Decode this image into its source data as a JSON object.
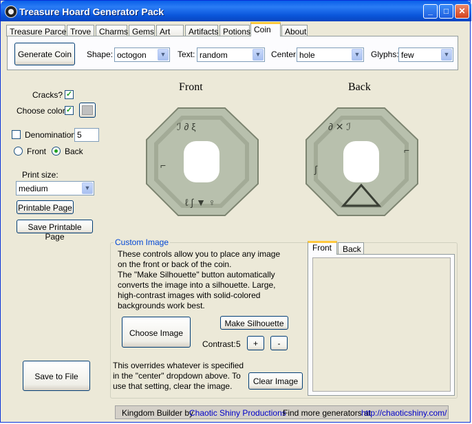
{
  "window": {
    "title": "Treasure Hoard Generator Pack"
  },
  "tabs": [
    "Treasure Parcel",
    "Trove",
    "Charms",
    "Gems",
    "Art",
    "Artifacts",
    "Potions",
    "Coin",
    "About"
  ],
  "toolbar": {
    "generate_label": "Generate Coin",
    "shape_label": "Shape:",
    "shape_value": "octogon",
    "text_label": "Text:",
    "text_value": "random",
    "center_label": "Center:",
    "center_value": "hole",
    "glyphs_label": "Glyphs:",
    "glyphs_value": "few"
  },
  "left": {
    "cracks_label": "Cracks?",
    "cracks_checked": true,
    "color_label": "Choose color",
    "color_checked": true,
    "color_swatch": "#c0c0c0",
    "denomination_label": "Denomination",
    "denomination_value": "5",
    "denomination_checked": false,
    "front_label": "Front",
    "back_label": "Back",
    "selected_side": "Back",
    "print_size_label": "Print size:",
    "print_size_value": "medium",
    "printable_label": "Printable Page",
    "save_printable_label": "Save Printable Page",
    "save_file_label": "Save to File"
  },
  "coins": {
    "front_label": "Front",
    "back_label": "Back",
    "coin_color": "#b8c0ad"
  },
  "custom": {
    "title": "Custom Image",
    "desc": [
      "These controls allow you to place any image",
      "on the front or back of the coin.",
      "The \"Make Silhouette\" button automatically",
      "converts the image into a silhouette. Large,",
      "high-contrast  images with solid-colored",
      "backgrounds work best."
    ],
    "choose_label": "Choose Image",
    "silhouette_label": "Make Silhouette",
    "contrast_label": "Contrast:",
    "contrast_value": "5",
    "plus_label": "+",
    "minus_label": "-",
    "override": [
      "This overrides whatever is specified",
      "in the \"center\" dropdown above. To",
      "use that setting, clear the image."
    ],
    "clear_label": "Clear Image",
    "tab_front": "Front",
    "tab_back": "Back"
  },
  "status": {
    "prefix": "Kingdom Builder by",
    "author": "Chaotic Shiny Productions",
    "more": "Find more generators at",
    "url": "http://chaoticshiny.com/"
  }
}
